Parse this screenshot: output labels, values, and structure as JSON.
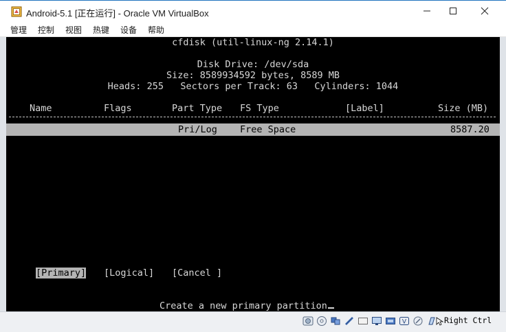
{
  "window": {
    "title": "Android-5.1 [正在运行] - Oracle VM VirtualBox",
    "menu": [
      "管理",
      "控制",
      "视图",
      "热键",
      "设备",
      "帮助"
    ]
  },
  "screen": {
    "header": {
      "app": "cfdisk (util-linux-ng 2.14.1)",
      "disk_drive": "Disk Drive: /dev/sda",
      "size": "Size: 8589934592 bytes, 8589 MB",
      "geometry": "Heads: 255   Sectors per Track: 63   Cylinders: 1044"
    },
    "columns": [
      "Name",
      "Flags",
      "Part Type",
      "FS Type",
      "[Label]",
      "Size (MB)"
    ],
    "rows": [
      {
        "name": "",
        "flags": "",
        "part_type": "Pri/Log",
        "fs_type": "Free Space",
        "label": "",
        "size_mb": "8587.20"
      }
    ],
    "buttons": [
      "[Primary]",
      "[Logical]",
      "[Cancel ]"
    ],
    "selected_button": "[Primary]",
    "status_message": "Create a new primary partition"
  },
  "statusbar": {
    "icons": [
      "hard-disk-icon",
      "optical-drive-icon",
      "usb-icon",
      "network-icon",
      "shared-folders-icon",
      "display-icon",
      "video-capture-icon",
      "recording-icon",
      "mouse-integration-icon",
      "keyboard-icon",
      "arrow-icon"
    ],
    "host_key": "Right Ctrl"
  },
  "colors": {
    "screen_bg": "#000000",
    "screen_text": "#d8d8d8",
    "selection_bg": "#b4b4b4",
    "titlebar_accent": "#1e73be"
  }
}
